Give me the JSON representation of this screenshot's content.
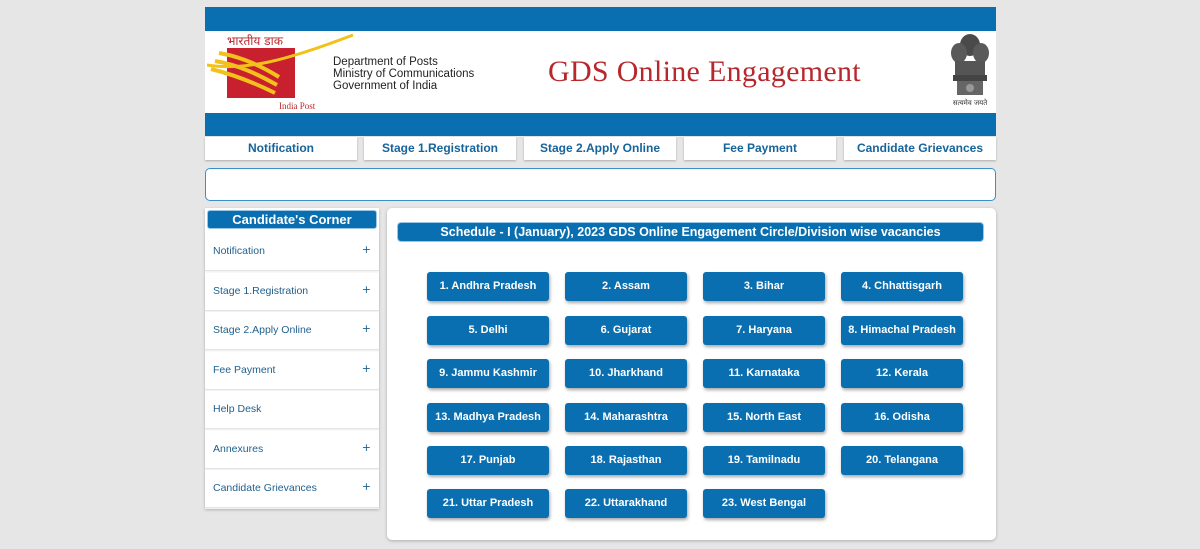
{
  "header": {
    "logo_hindi": "भारतीय डाक",
    "logo_caption": "India Post",
    "department_lines": [
      "Department of Posts",
      "Ministry of Communications",
      "Government of India"
    ],
    "title": "GDS Online Engagement",
    "emblem_motto": "सत्यमेव जयते",
    "colors": {
      "brand_blue": "#0a6fb0",
      "brand_red": "#b7282e",
      "logo_yellow": "#f2c21b"
    }
  },
  "nav": {
    "items": [
      {
        "label": "Notification"
      },
      {
        "label": "Stage 1.Registration"
      },
      {
        "label": "Stage 2.Apply Online"
      },
      {
        "label": "Fee Payment"
      },
      {
        "label": "Candidate Grievances"
      }
    ]
  },
  "sidebar": {
    "heading": "Candidate's Corner",
    "items": [
      {
        "label": "Notification",
        "expand": "+"
      },
      {
        "label": "Stage 1.Registration",
        "expand": "+"
      },
      {
        "label": "Stage 2.Apply Online",
        "expand": "+"
      },
      {
        "label": "Fee Payment",
        "expand": "+"
      },
      {
        "label": "Help Desk",
        "expand": ""
      },
      {
        "label": "Annexures",
        "expand": "+"
      },
      {
        "label": "Candidate Grievances",
        "expand": "+"
      }
    ]
  },
  "main": {
    "schedule_title": "Schedule - I (January), 2023 GDS Online Engagement Circle/Division wise vacancies",
    "circles": [
      "1. Andhra Pradesh",
      "2. Assam",
      "3. Bihar",
      "4. Chhattisgarh",
      "5. Delhi",
      "6. Gujarat",
      "7. Haryana",
      "8. Himachal Pradesh",
      "9. Jammu Kashmir",
      "10. Jharkhand",
      "11. Karnataka",
      "12. Kerala",
      "13. Madhya Pradesh",
      "14. Maharashtra",
      "15. North East",
      "16. Odisha",
      "17. Punjab",
      "18. Rajasthan",
      "19. Tamilnadu",
      "20. Telangana",
      "21. Uttar Pradesh",
      "22. Uttarakhand",
      "23. West Bengal"
    ]
  }
}
